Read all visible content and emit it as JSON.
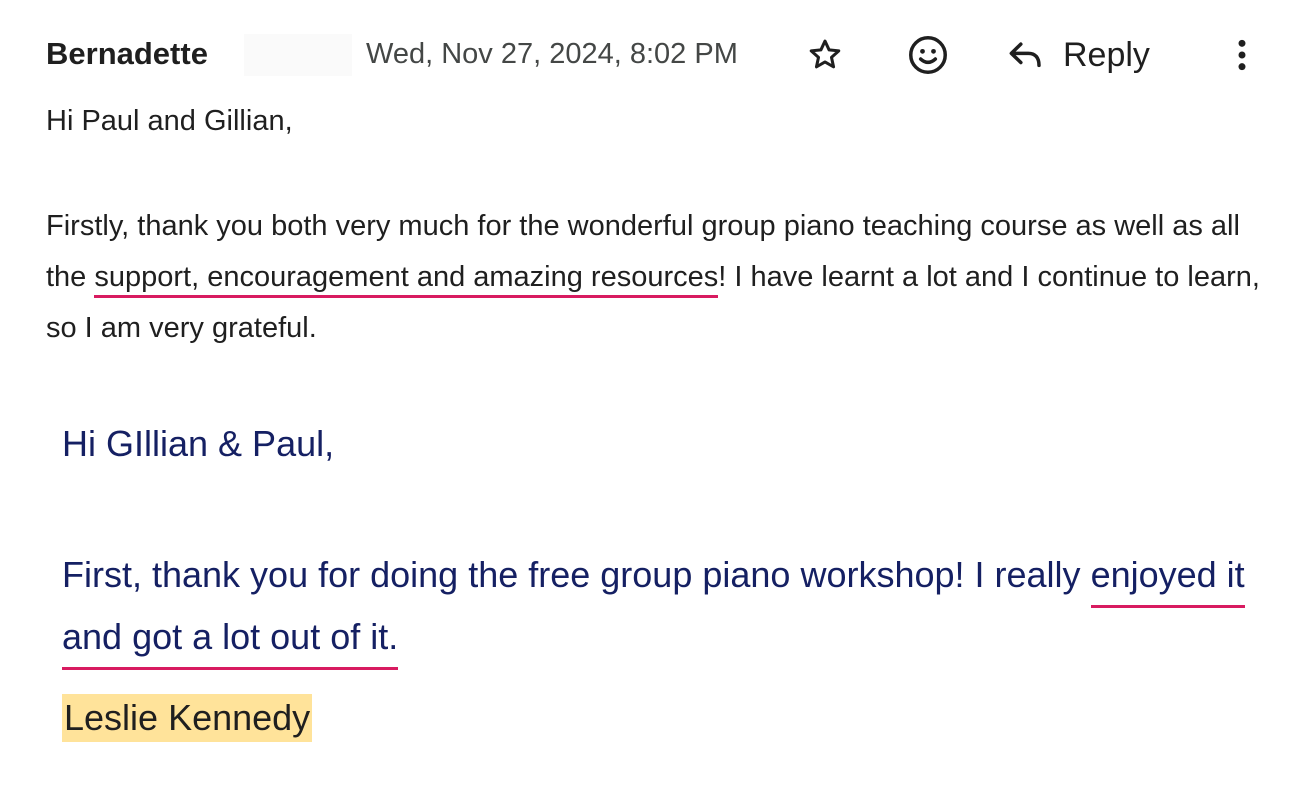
{
  "header": {
    "sender": "Bernadette",
    "date": "Wed, Nov 27, 2024, 8:02 PM",
    "reply_label": "Reply",
    "icons": [
      "star-icon",
      "emoji-icon",
      "reply-icon",
      "more-vert-icon"
    ]
  },
  "email": {
    "greeting": "Hi Paul and Gillian,",
    "para_before": "Firstly, thank you both very much for the wonderful group piano teaching course as well as all the",
    "para_highlight": "support, encouragement and amazing resources",
    "para_after": "! I have learnt a lot and I continue to learn, so I am very grateful."
  },
  "quote": {
    "greeting": "Hi GIllian & Paul,",
    "body_start": "First, thank you for doing the free group piano workshop! I really",
    "body_highlight": "enjoyed it and got a lot out of it.",
    "name": "Leslie Kennedy"
  },
  "colors": {
    "underline": "#d81b60",
    "quote_text": "#152063",
    "name_highlight": "#ffe39a"
  }
}
